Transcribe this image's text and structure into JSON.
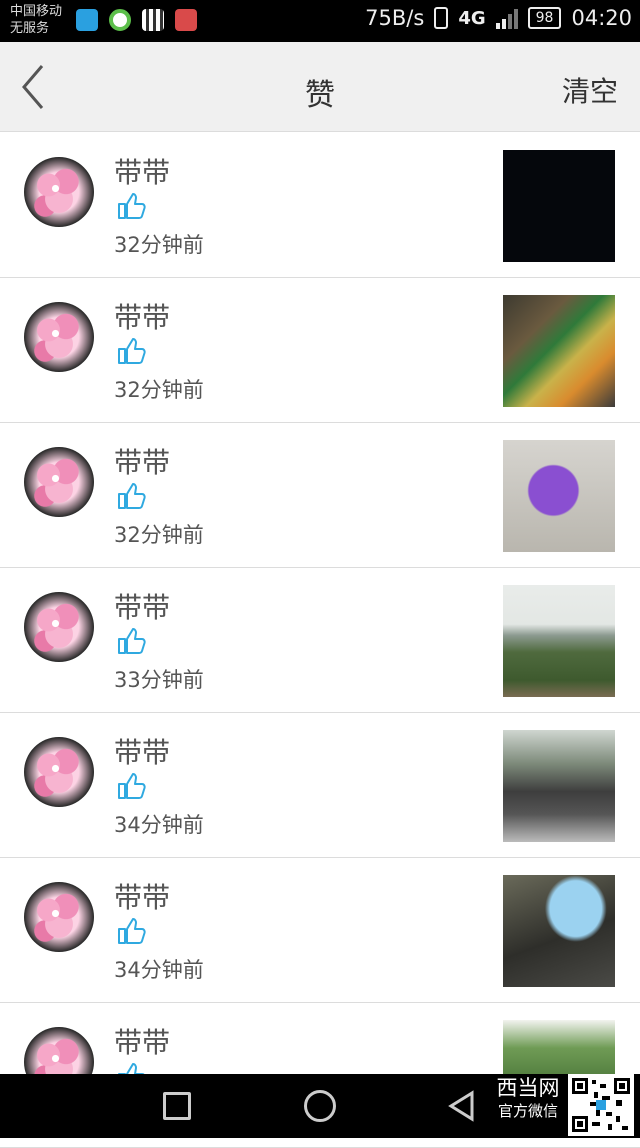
{
  "status_bar": {
    "carrier_line1": "中国移动",
    "carrier_line2": "无服务",
    "speed": "75B/s",
    "network": "4G",
    "battery": "98",
    "time": "04:20"
  },
  "header": {
    "title": "赞",
    "clear_label": "清空",
    "back_icon": "chevron-left-icon"
  },
  "likes": [
    {
      "name": "带带",
      "time": "32分钟前",
      "thumb": "dark"
    },
    {
      "name": "带带",
      "time": "32分钟前",
      "thumb": "market"
    },
    {
      "name": "带带",
      "time": "32分钟前",
      "thumb": "purple-cart"
    },
    {
      "name": "带带",
      "time": "33分钟前",
      "thumb": "mountain"
    },
    {
      "name": "带带",
      "time": "34分钟前",
      "thumb": "crowd"
    },
    {
      "name": "带带",
      "time": "34分钟前",
      "thumb": "screen"
    },
    {
      "name": "带带",
      "time": "",
      "thumb": "trees"
    }
  ],
  "watermark": {
    "title": "西当网",
    "subtitle": "官方微信"
  },
  "colors": {
    "like_icon": "#2fa9e0",
    "header_bg": "#f0f0f0",
    "divider": "#dcdcdc"
  }
}
